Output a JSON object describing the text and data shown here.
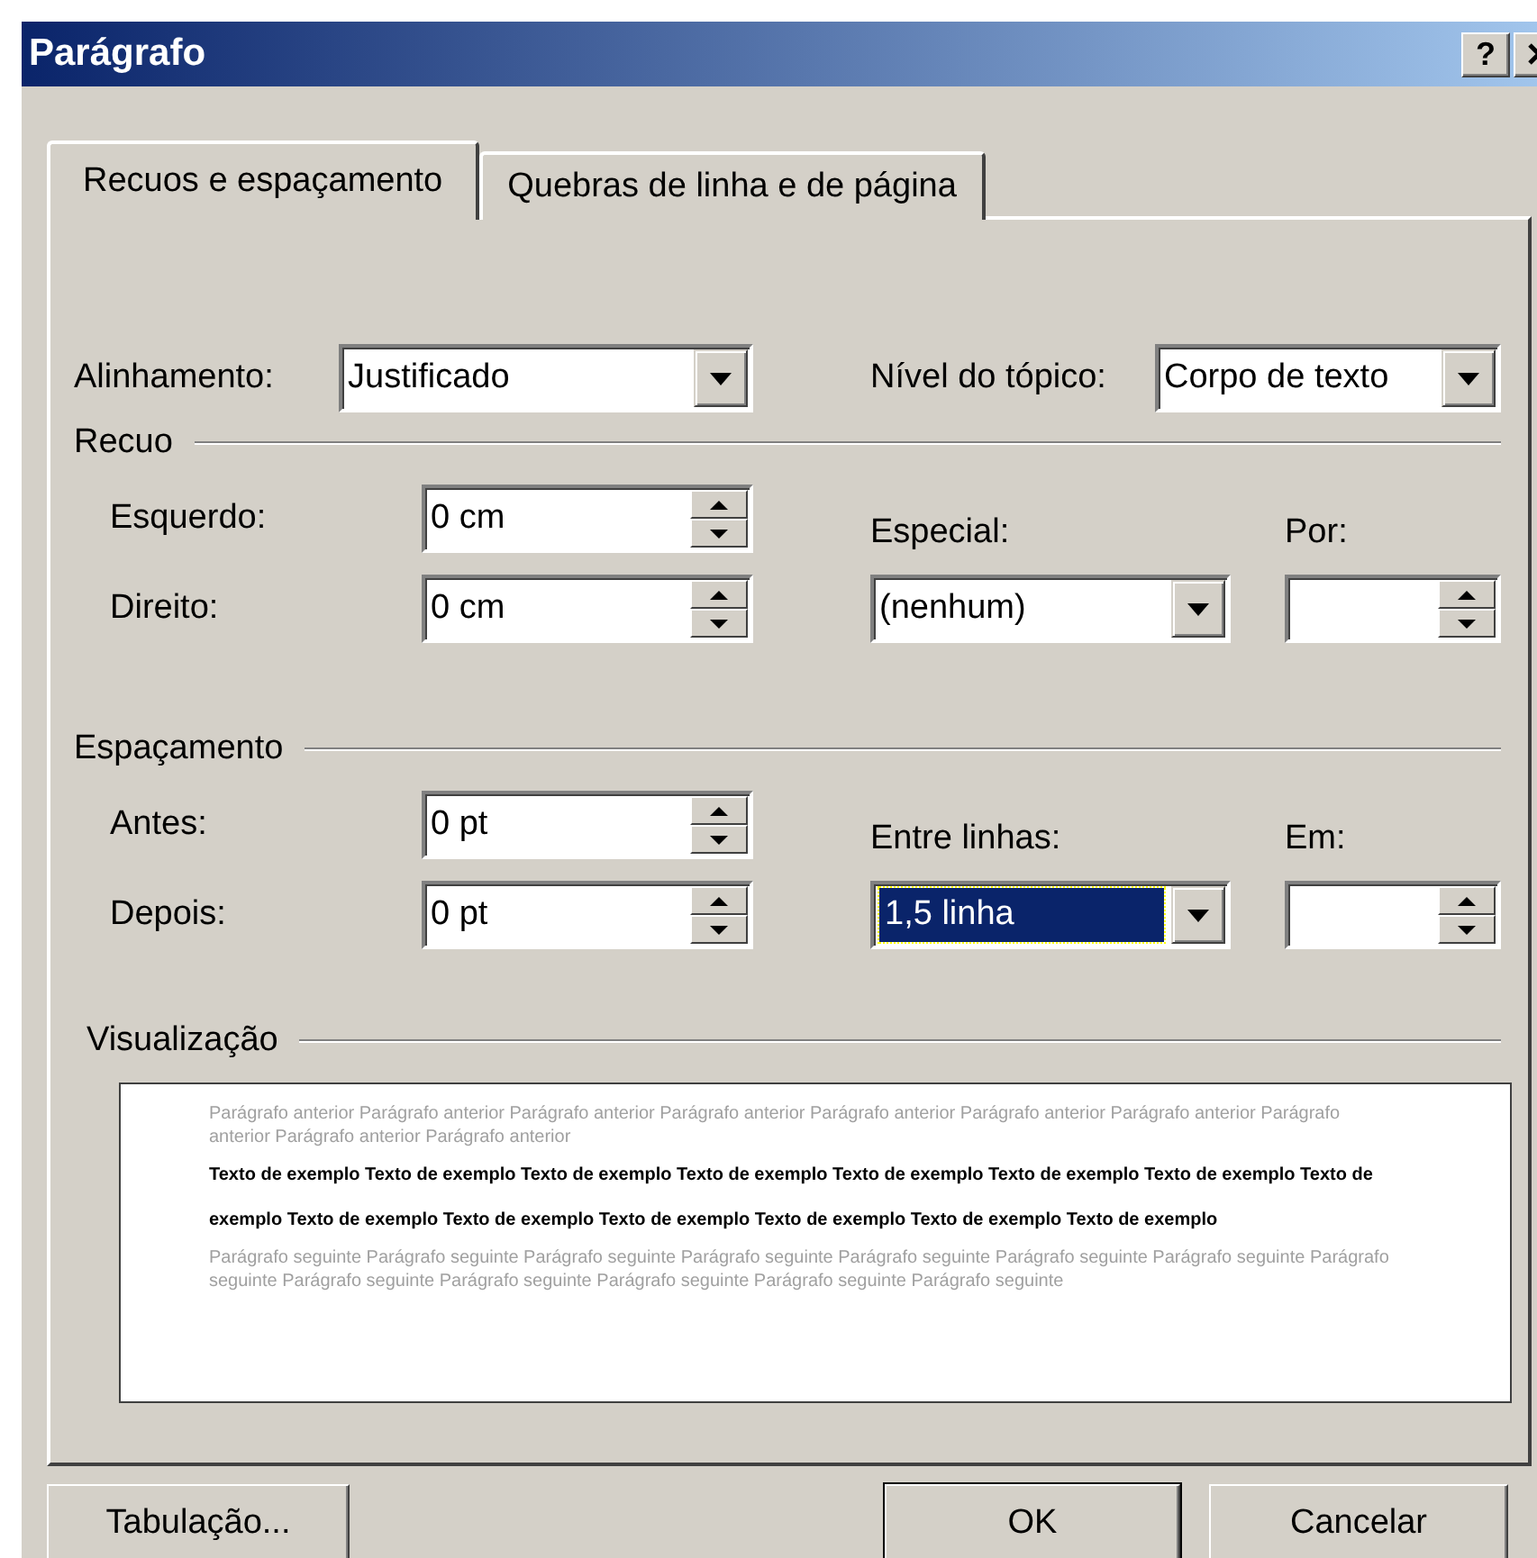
{
  "window": {
    "title": "Parágrafo",
    "help_button": "?"
  },
  "tabs": [
    {
      "label": "Recuos e espaçamento",
      "selected": true
    },
    {
      "label": "Quebras de linha e de página",
      "selected": false
    }
  ],
  "alignment": {
    "label": "Alinhamento:",
    "value": "Justificado"
  },
  "outline_level": {
    "label": "Nível do tópico:",
    "value": "Corpo de texto"
  },
  "indent": {
    "title": "Recuo",
    "left": {
      "label": "Esquerdo:",
      "value": "0 cm"
    },
    "right": {
      "label": "Direito:",
      "value": "0 cm"
    },
    "special": {
      "label": "Especial:",
      "value": "(nenhum)"
    },
    "by": {
      "label": "Por:"
    }
  },
  "spacing": {
    "title": "Espaçamento",
    "before": {
      "label": "Antes:",
      "value": "0 pt"
    },
    "after": {
      "label": "Depois:",
      "value": "0 pt"
    },
    "line_spacing": {
      "label": "Entre linhas:",
      "value": "1,5 linha",
      "focused": true
    },
    "at": {
      "label": "Em:"
    }
  },
  "preview": {
    "title": "Visualização",
    "previous": "Parágrafo anterior Parágrafo anterior Parágrafo anterior Parágrafo anterior Parágrafo anterior Parágrafo anterior Parágrafo anterior Parágrafo anterior Parágrafo anterior Parágrafo anterior",
    "sample": "Texto de exemplo Texto de exemplo Texto de exemplo Texto de exemplo Texto de exemplo Texto de exemplo Texto de exemplo Texto de exemplo Texto de exemplo Texto de exemplo Texto de exemplo Texto de exemplo Texto de exemplo Texto de exemplo",
    "next": "Parágrafo seguinte Parágrafo seguinte Parágrafo seguinte Parágrafo seguinte Parágrafo seguinte Parágrafo seguinte Parágrafo seguinte Parágrafo seguinte Parágrafo seguinte Parágrafo seguinte Parágrafo seguinte Parágrafo seguinte Parágrafo seguinte"
  },
  "buttons": [
    {
      "label": "Tabulação...",
      "default": false
    },
    {
      "label": "OK",
      "default": true
    },
    {
      "label": "Cancelar",
      "default": false
    }
  ]
}
